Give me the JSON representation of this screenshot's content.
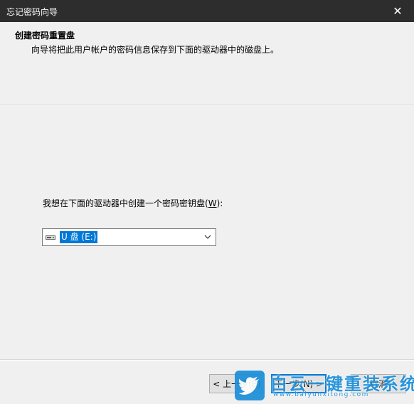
{
  "window": {
    "title": "忘记密码向导",
    "close_glyph": "✕"
  },
  "header": {
    "title": "创建密码重置盘",
    "subtitle": "向导将把此用户帐户的密码信息保存到下面的驱动器中的磁盘上。"
  },
  "main": {
    "prompt_text": "我想在下面的驱动器中创建一个密码密钥盘(",
    "prompt_accel": "W",
    "prompt_tail": "):",
    "drive_select": {
      "selected": "U 盘 (E:)",
      "icon": "usb-drive-icon"
    }
  },
  "buttons": {
    "back_label": "< 上一步(B)",
    "next_label": "下一步(N) >",
    "cancel_label": "取消"
  },
  "watermark": {
    "brand": "白云一键重装系统",
    "url": "www.baiyunxitong.com"
  },
  "colors": {
    "titlebar": "#2d2d2d",
    "selection": "#0078d7",
    "watermark": "#1a8ed8"
  }
}
